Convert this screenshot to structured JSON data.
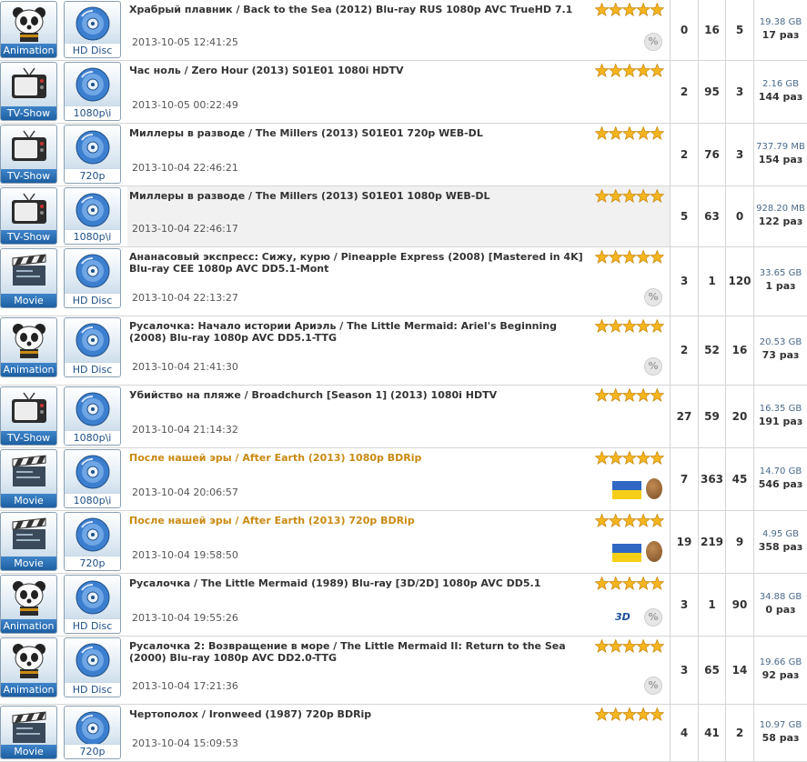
{
  "columns": {
    "rating_stars": 5
  },
  "torrents": [
    {
      "category": "Animation",
      "category_icon": "panda-icon",
      "format": "HD Disc",
      "format_icon": "disc-icon",
      "title": "Храбрый плавник / Back to the Sea (2012) Blu-ray RUS 1080p AVC TrueHD 7.1",
      "date": "2013-10-05 12:41:25",
      "badge": "%",
      "seeders": "0",
      "leechers": "16",
      "completed": "5",
      "size": "19.38 GB",
      "downloads": "17 раз"
    },
    {
      "category": "TV-Show",
      "category_icon": "tv-icon",
      "format": "1080p\\i",
      "format_icon": "disc-icon",
      "title": "Час ноль / Zero Hour (2013) S01E01 1080i HDTV",
      "date": "2013-10-05 00:22:49",
      "seeders": "2",
      "leechers": "95",
      "completed": "3",
      "size": "2.16 GB",
      "downloads": "144 раз"
    },
    {
      "category": "TV-Show",
      "category_icon": "tv-icon",
      "format": "720p",
      "format_icon": "disc-icon",
      "title": "Миллеры в разводе / The Millers (2013) S01E01 720p WEB-DL",
      "date": "2013-10-04 22:46:21",
      "seeders": "2",
      "leechers": "76",
      "completed": "3",
      "size": "737.79 MB",
      "downloads": "154 раз"
    },
    {
      "category": "TV-Show",
      "category_icon": "tv-icon",
      "format": "1080p\\i",
      "format_icon": "disc-icon",
      "title": "Миллеры в разводе / The Millers (2013) S01E01 1080p WEB-DL",
      "date": "2013-10-04 22:46:17",
      "seeders": "5",
      "leechers": "63",
      "completed": "0",
      "size": "928.20 MB",
      "downloads": "122 раз",
      "highlight": true
    },
    {
      "category": "Movie",
      "category_icon": "clapperboard-icon",
      "format": "HD Disc",
      "format_icon": "disc-icon",
      "title": "Ананасовый экспресс: Сижу, курю / Pineapple Express (2008) [Mastered in 4K] Blu-ray CEE 1080p AVC DD5.1-Mont",
      "date": "2013-10-04 22:13:27",
      "badge": "%",
      "seeders": "3",
      "leechers": "1",
      "completed": "120",
      "size": "33.65 GB",
      "downloads": "1 раз"
    },
    {
      "category": "Animation",
      "category_icon": "panda-icon",
      "format": "HD Disc",
      "format_icon": "disc-icon",
      "title": "Русалочка: Начало истории Ариэль / The Little Mermaid: Ariel's Beginning (2008) Blu-ray 1080p AVC DD5.1-TTG",
      "date": "2013-10-04 21:41:30",
      "badge": "%",
      "seeders": "2",
      "leechers": "52",
      "completed": "16",
      "size": "20.53 GB",
      "downloads": "73 раз"
    },
    {
      "category": "TV-Show",
      "category_icon": "tv-icon",
      "format": "1080p\\i",
      "format_icon": "disc-icon",
      "title": "Убийство на пляже / Broadchurch [Season 1] (2013) 1080i HDTV",
      "date": "2013-10-04 21:14:32",
      "seeders": "27",
      "leechers": "59",
      "completed": "20",
      "size": "16.35 GB",
      "downloads": "191 раз"
    },
    {
      "category": "Movie",
      "category_icon": "clapperboard-icon",
      "format": "1080p\\i",
      "format_icon": "disc-icon",
      "title": "После нашей эры / After Earth (2013) 1080p BDRip",
      "title_color": "orange",
      "date": "2013-10-04 20:06:57",
      "flags": true,
      "seeders": "7",
      "leechers": "363",
      "completed": "45",
      "size": "14.70 GB",
      "downloads": "546 раз"
    },
    {
      "category": "Movie",
      "category_icon": "clapperboard-icon",
      "format": "720p",
      "format_icon": "disc-icon",
      "title": "После нашей эры / After Earth (2013) 720p BDRip",
      "title_color": "orange",
      "date": "2013-10-04 19:58:50",
      "flags": true,
      "seeders": "19",
      "leechers": "219",
      "completed": "9",
      "size": "4.95 GB",
      "downloads": "358 раз"
    },
    {
      "category": "Animation",
      "category_icon": "panda-icon",
      "format": "HD Disc",
      "format_icon": "disc-icon",
      "title": "Русалочка / The Little Mermaid (1989) Blu-ray [3D/2D] 1080p AVC DD5.1",
      "date": "2013-10-04 19:55:26",
      "badge": "%",
      "tag3d": "3D",
      "seeders": "3",
      "leechers": "1",
      "completed": "90",
      "size": "34.88 GB",
      "downloads": "0 раз"
    },
    {
      "category": "Animation",
      "category_icon": "panda-icon",
      "format": "HD Disc",
      "format_icon": "disc-icon",
      "title": "Русалочка 2: Возвращение в море / The Little Mermaid II: Return to the Sea (2000) Blu-ray 1080p AVC DD2.0-TTG",
      "date": "2013-10-04 17:21:36",
      "badge": "%",
      "seeders": "3",
      "leechers": "65",
      "completed": "14",
      "size": "19.66 GB",
      "downloads": "92 раз"
    },
    {
      "category": "Movie",
      "category_icon": "clapperboard-icon",
      "format": "720p",
      "format_icon": "disc-icon",
      "title": "Чертополох / Ironweed (1987) 720p BDRip",
      "date": "2013-10-04 15:09:53",
      "seeders": "4",
      "leechers": "41",
      "completed": "2",
      "size": "10.97 GB",
      "downloads": "58 раз"
    }
  ]
}
